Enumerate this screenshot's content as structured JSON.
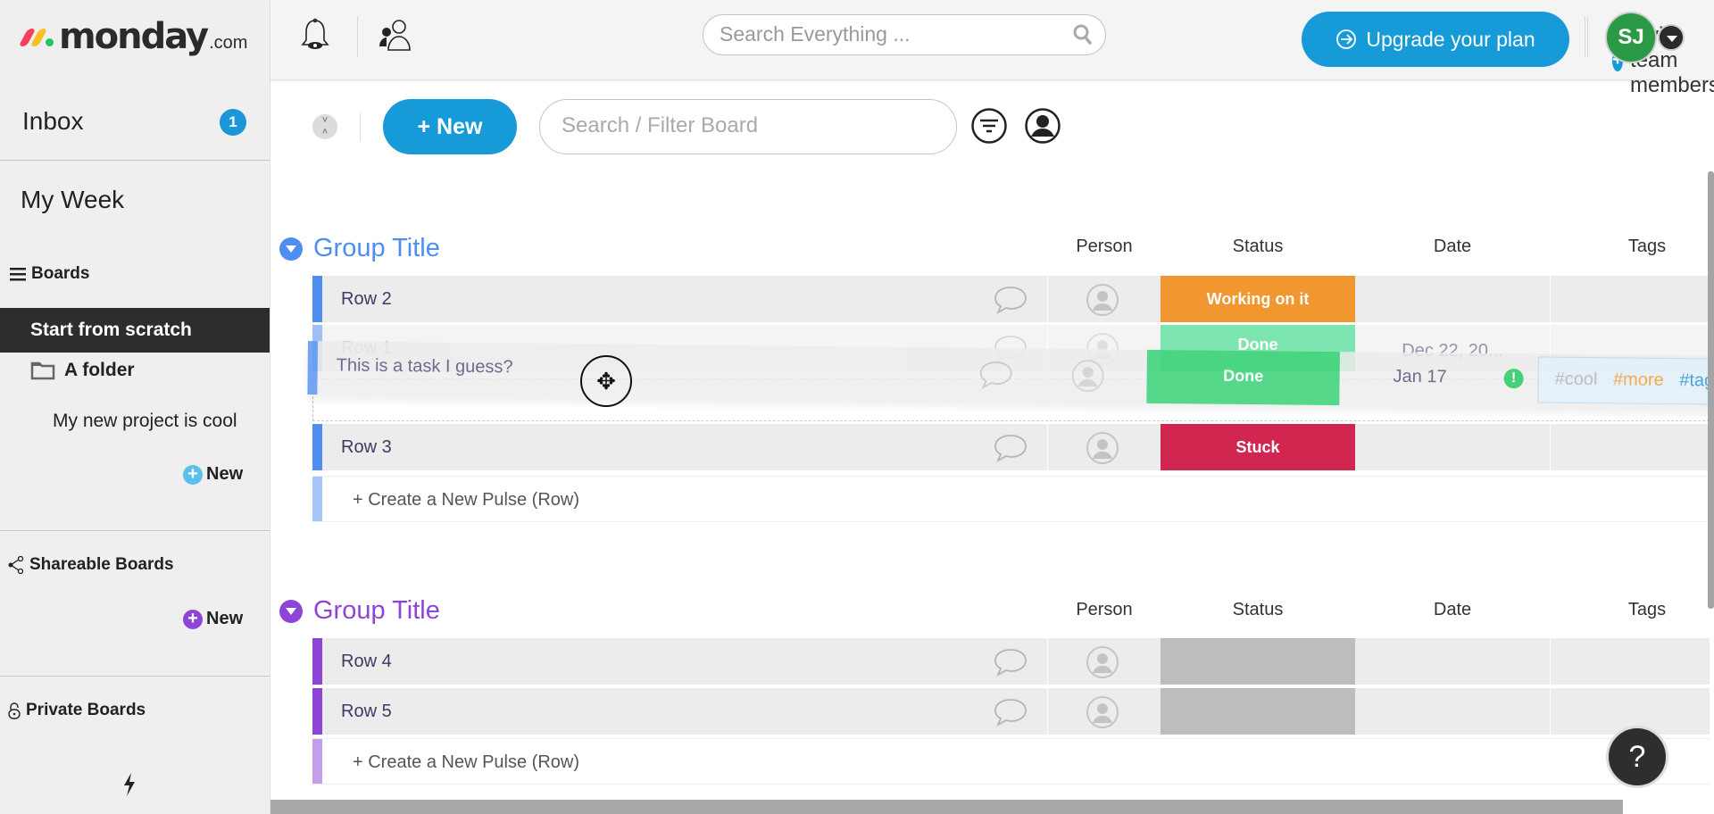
{
  "app": {
    "logo_text": "monday",
    "logo_suffix": ".com"
  },
  "sidebar": {
    "inbox_label": "Inbox",
    "inbox_count": "1",
    "my_week_label": "My Week",
    "boards_label": "Boards",
    "active_board": "Start from scratch",
    "folder_label": "A folder",
    "folder_items": [
      "My new project is cool"
    ],
    "new_label": "New",
    "shareable_label": "Shareable Boards",
    "shareable_new_label": "New",
    "private_label": "Private Boards",
    "colors": {
      "new_plus": "#5bc0eb",
      "shareable_plus": "#8e44d6",
      "active_bg": "#2d2d2d"
    }
  },
  "topbar": {
    "search_placeholder": "Search Everything ...",
    "upgrade_label": "Upgrade your plan",
    "invite_label": "Invite team members",
    "avatar_initials": "SJ",
    "accent": "#179bd8"
  },
  "board_toolbar": {
    "new_label": "+ New",
    "filter_placeholder": "Search / Filter Board"
  },
  "columns": [
    "Person",
    "Status",
    "Date",
    "Tags"
  ],
  "groups": [
    {
      "title": "Group Title",
      "color": "#4d8ef0",
      "rows": [
        {
          "name": "Row 2",
          "status": "Working on it",
          "status_color": "#f2962f",
          "date": ""
        },
        {
          "name": "Row 1",
          "status": "Done",
          "status_color": "#14d071",
          "date": "Dec 22, 20..."
        },
        {
          "name": "Row 3",
          "status": "Stuck",
          "status_color": "#d02650",
          "date": ""
        }
      ],
      "create_label": "+ Create a New Pulse (Row)"
    },
    {
      "title": "Group Title",
      "color": "#8e44d6",
      "rows": [
        {
          "name": "Row 4",
          "status": "",
          "status_color": "#bdbdbd",
          "date": ""
        },
        {
          "name": "Row 5",
          "status": "",
          "status_color": "#bdbdbd",
          "date": ""
        }
      ],
      "create_label": "+ Create a New Pulse (Row)"
    }
  ],
  "dragged_row": {
    "name": "This is a task I guess?",
    "status": "Done",
    "date": "Jan 17",
    "warning": "!",
    "tags": [
      {
        "text": "#cool",
        "color": "#b8b8b8"
      },
      {
        "text": "#more",
        "color": "#f2a33a"
      },
      {
        "text": "#tags",
        "color": "#3a9ad9"
      }
    ]
  },
  "help_label": "?"
}
